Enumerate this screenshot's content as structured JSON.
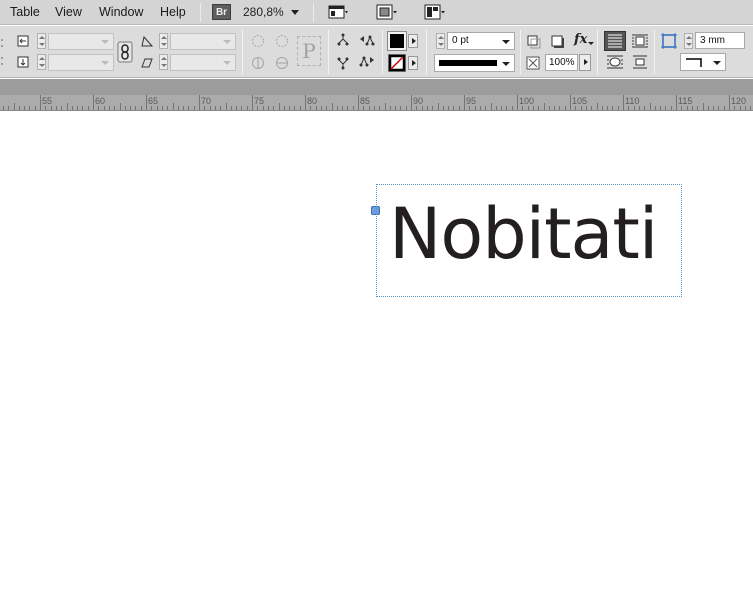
{
  "menubar": {
    "items": [
      {
        "label": "Table"
      },
      {
        "label": "View"
      },
      {
        "label": "Window"
      },
      {
        "label": "Help"
      }
    ],
    "bridge_label": "Br",
    "zoom": "280,8%"
  },
  "control_panel": {
    "stroke_weight": "0 pt",
    "opacity": "100%",
    "gap_value": "3 mm",
    "paragraph_icon_label": "P",
    "fx_label": "fx"
  },
  "ruler": {
    "labels": [
      "55",
      "60",
      "65",
      "70",
      "75",
      "80",
      "85",
      "90",
      "95",
      "100",
      "105",
      "110",
      "115",
      "120"
    ]
  },
  "document": {
    "frame_text": "Nobitati"
  },
  "colors": {
    "menubar_bg": "#d4d4d4",
    "panel_bg": "#dcdcdc",
    "ruler_bg": "#ababab",
    "frame_border": "#5a8fc8",
    "text_color": "#231f20"
  }
}
